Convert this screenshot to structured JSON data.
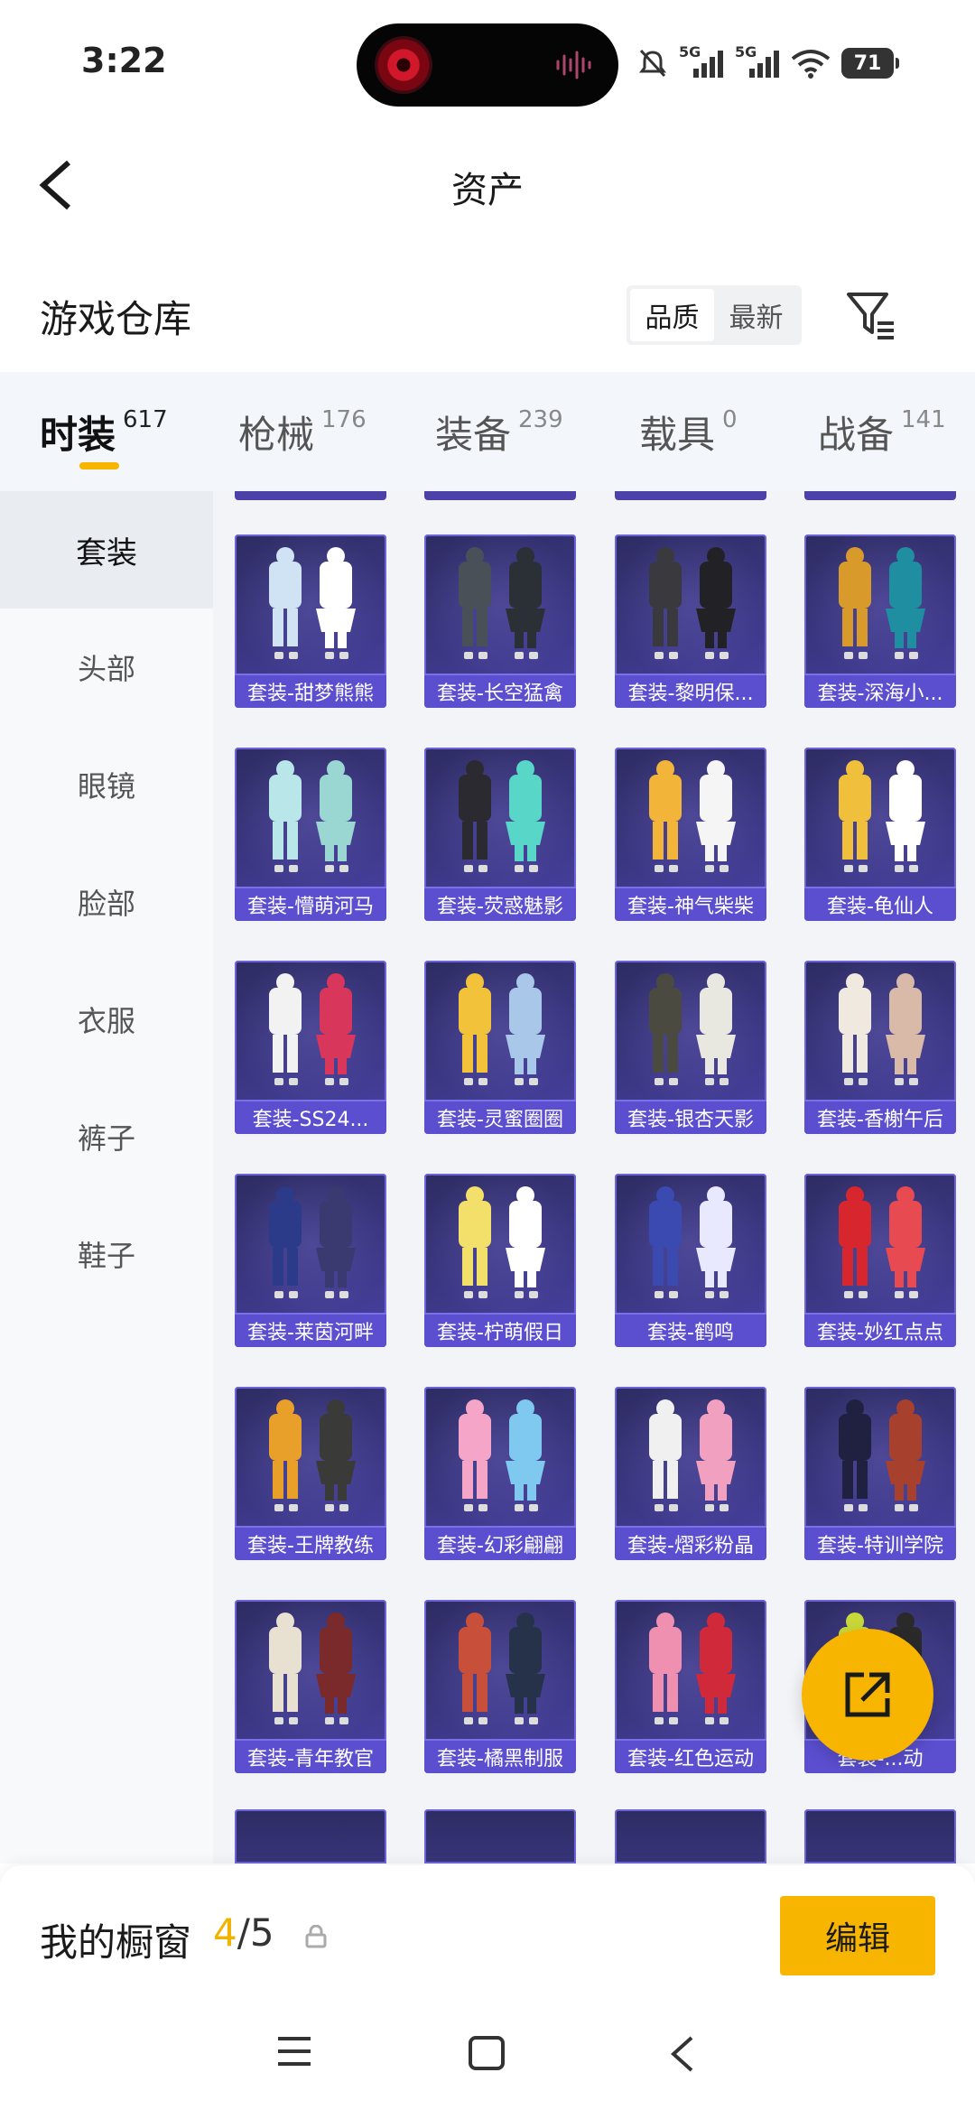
{
  "status_bar": {
    "time": "3:22",
    "network_1": "5G",
    "network_2": "5G",
    "battery": "71"
  },
  "header": {
    "title": "资产"
  },
  "warehouse": {
    "title": "游戏仓库",
    "sort_options": [
      "品质",
      "最新"
    ],
    "active_sort": "品质"
  },
  "tabs": [
    {
      "label": "时装",
      "count": "617",
      "active": true
    },
    {
      "label": "枪械",
      "count": "176",
      "active": false
    },
    {
      "label": "装备",
      "count": "239",
      "active": false
    },
    {
      "label": "载具",
      "count": "0",
      "active": false
    },
    {
      "label": "战备",
      "count": "141",
      "active": false
    }
  ],
  "sidebar": {
    "items": [
      "套装",
      "头部",
      "眼镜",
      "脸部",
      "衣服",
      "裤子",
      "鞋子"
    ],
    "active": "套装"
  },
  "items": [
    "套装-甜梦熊熊",
    "套装-长空猛禽",
    "套装-黎明保...",
    "套装-深海小...",
    "套装-懵萌河马",
    "套装-荧惑魅影",
    "套装-神气柴柴",
    "套装-龟仙人",
    "套装-SS24...",
    "套装-灵蜜圈圈",
    "套装-银杏天影",
    "套装-香榭午后",
    "套装-莱茵河畔",
    "套装-柠萌假日",
    "套装-鹤鸣",
    "套装-妙红点点",
    "套装-王牌教练",
    "套装-幻彩翩翩",
    "套装-熠彩粉晶",
    "套装-特训学院",
    "套装-青年教官",
    "套装-橘黑制服",
    "套装-红色运动",
    "套装-...动"
  ],
  "showcase": {
    "title": "我的橱窗",
    "current": "4",
    "separator": "/",
    "total": "5",
    "edit_label": "编辑"
  },
  "colors": {
    "accent": "#f7b500",
    "card_bg": "#3c3784",
    "card_label_bg": "#5b4fd0"
  },
  "icons": {
    "back": "back-arrow-icon",
    "filter": "filter-icon",
    "share": "share-external-icon",
    "lock": "lock-icon",
    "nav_menu": "menu-icon",
    "nav_home": "home-square-icon",
    "nav_back": "back-chevron-icon"
  }
}
